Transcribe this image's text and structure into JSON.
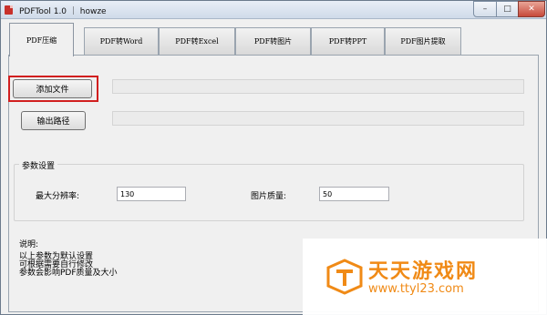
{
  "window": {
    "title": "PDFTool 1.0 ｜ howze",
    "controls": {
      "minimize": "–",
      "maximize": "□",
      "close": "✕"
    }
  },
  "tabs": [
    {
      "label": "PDF压缩",
      "active": true
    },
    {
      "label": "PDF转Word",
      "active": false
    },
    {
      "label": "PDF转Excel",
      "active": false
    },
    {
      "label": "PDF转图片",
      "active": false
    },
    {
      "label": "PDF转PPT",
      "active": false
    },
    {
      "label": "PDF图片提取",
      "active": false
    }
  ],
  "actions": {
    "add_file": "添加文件",
    "output_path": "输出路径"
  },
  "fields": {
    "file_list_value": "",
    "output_path_value": ""
  },
  "params": {
    "group_title": "参数设置",
    "max_resolution_label": "最大分辨率:",
    "max_resolution_value": "130",
    "image_quality_label": "图片质量:",
    "image_quality_value": "50"
  },
  "notes": {
    "title": "说明:",
    "lines": [
      "以上参数为默认设置",
      "可根据需要自行修改",
      "参数会影响PDF质量及大小"
    ]
  },
  "watermark": {
    "title": "天天游戏网",
    "url": "www.ttyl23.com"
  },
  "colors": {
    "highlight": "#d11f1f",
    "watermark": "#f08a16",
    "close_button": "#c7493a"
  }
}
